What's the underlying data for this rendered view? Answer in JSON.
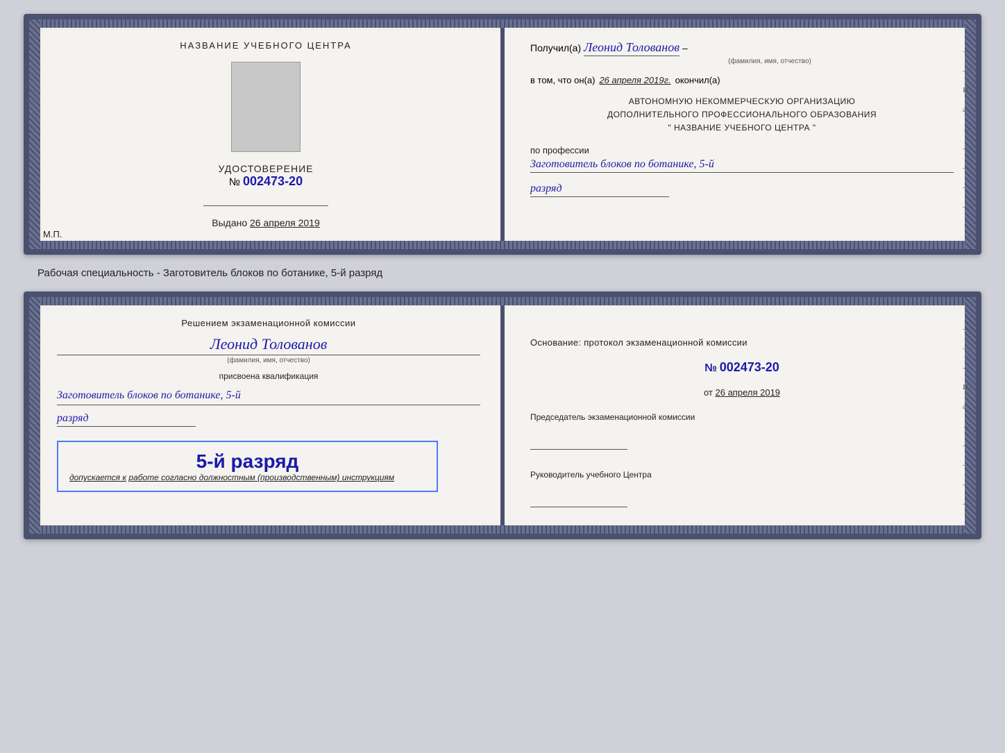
{
  "top_card": {
    "left": {
      "org_title": "НАЗВАНИЕ УЧЕБНОГО ЦЕНТРА",
      "cert_label": "УДОСТОВЕРЕНИЕ",
      "cert_number_prefix": "№",
      "cert_number": "002473-20",
      "issued_label": "Выдано",
      "issued_date": "26 апреля 2019",
      "mp_label": "М.П."
    },
    "right": {
      "received_prefix": "Получил(а)",
      "recipient_name": "Леонид Толованов",
      "fio_sublabel": "(фамилия, имя, отчество)",
      "in_that_prefix": "в том, что он(а)",
      "completed_date": "26 апреля 2019г.",
      "completed_suffix": "окончил(а)",
      "org_line1": "АВТОНОМНУЮ НЕКОММЕРЧЕСКУЮ ОРГАНИЗАЦИЮ",
      "org_line2": "ДОПОЛНИТЕЛЬНОГО ПРОФЕССИОНАЛЬНОГО ОБРАЗОВАНИЯ",
      "org_line3": "\"  НАЗВАНИЕ УЧЕБНОГО ЦЕНТРА  \"",
      "profession_label": "по профессии",
      "profession_name": "Заготовитель блоков по ботанике, 5-й",
      "razryad": "разряд"
    }
  },
  "caption": "Рабочая специальность - Заготовитель блоков по ботанике, 5-й разряд",
  "bottom_card": {
    "left": {
      "decision_text": "Решением экзаменационной комиссии",
      "person_name": "Леонид Толованов",
      "fio_sublabel": "(фамилия, имя, отчество)",
      "assigned_text": "присвоена квалификация",
      "profession_name": "Заготовитель блоков по ботанике, 5-й",
      "razryad": "разряд",
      "stamp_number": "5-й разряд",
      "allowed_prefix": "допускается к",
      "allowed_text": "работе согласно должностным (производственным) инструкциям"
    },
    "right": {
      "basis_text": "Основание: протокол экзаменационной комиссии",
      "protocol_prefix": "№",
      "protocol_number": "002473-20",
      "from_prefix": "от",
      "from_date": "26 апреля 2019",
      "chairman_label": "Председатель экзаменационной комиссии",
      "head_label": "Руководитель учебного Центра"
    }
  }
}
